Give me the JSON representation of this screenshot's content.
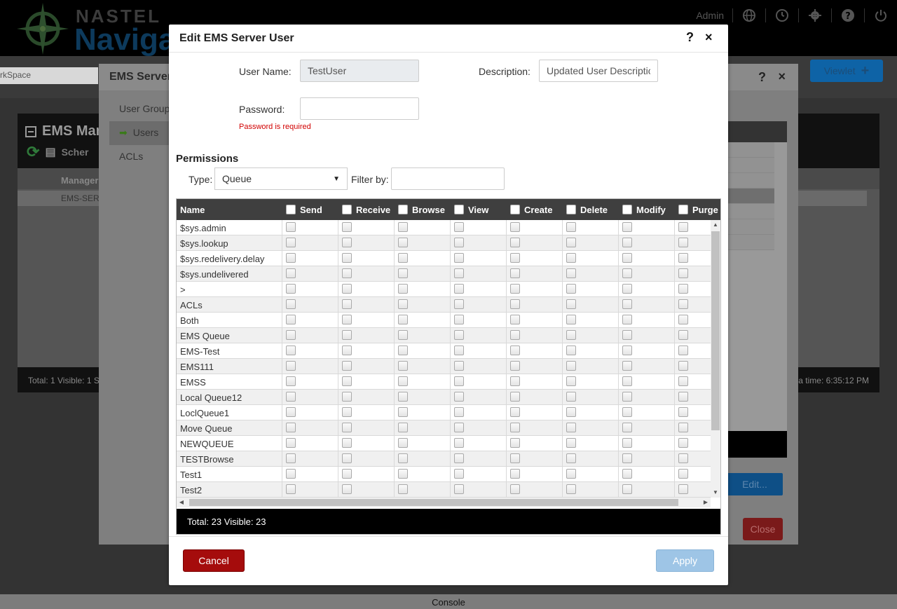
{
  "app": {
    "logo_top": "NASTEL",
    "logo_bottom": "Naviga",
    "user": "Admin",
    "workspace_tab": "rkSpace",
    "viewlet_button": "Viewlet",
    "console_label": "Console"
  },
  "background_panel": {
    "title": "EMS Mar",
    "tool_label": "Scher",
    "column_header": "Manager",
    "row_label": "EMS-SERV",
    "footer_left": "Total: 1 Visible: 1 S",
    "footer_right": "a time: 6:35:12 PM"
  },
  "server_dialog": {
    "title": "EMS Server",
    "help": "?",
    "close": "×",
    "nav": [
      "User Group",
      "Users",
      "ACLs"
    ],
    "edit_button": "Edit...",
    "close_button": "Close"
  },
  "dialog": {
    "title": "Edit EMS Server User",
    "help": "?",
    "close": "×",
    "user_name_label": "User Name:",
    "user_name_value": "TestUser",
    "description_label": "Description:",
    "description_value": "Updated User Descriptio",
    "password_label": "Password:",
    "password_value": "",
    "password_error": "Password is required",
    "permissions_title": "Permissions",
    "type_label": "Type:",
    "type_value": "Queue",
    "filter_label": "Filter by:",
    "filter_value": "",
    "footer": "Total: 23 Visible: 23",
    "cancel_button": "Cancel",
    "apply_button": "Apply"
  },
  "grid": {
    "name_header": "Name",
    "permission_columns": [
      "Send",
      "Receive",
      "Browse",
      "View",
      "Create",
      "Delete",
      "Modify",
      "Purge"
    ],
    "rows": [
      "$sys.admin",
      "$sys.lookup",
      "$sys.redelivery.delay",
      "$sys.undelivered",
      ">",
      "ACLs",
      "Both",
      "EMS Queue",
      "EMS-Test",
      "EMS111",
      "EMSS",
      "Local Queue12",
      "LoclQueue1",
      "Move Queue",
      "NEWQUEUE",
      "TESTBrowse",
      "Test1",
      "Test2"
    ]
  }
}
